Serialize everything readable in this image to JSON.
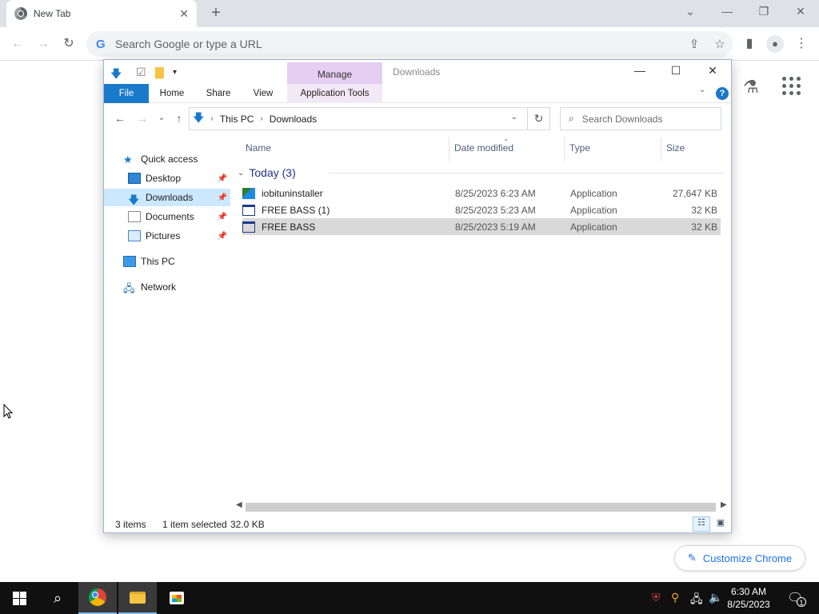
{
  "chrome": {
    "tab_title": "New Tab",
    "omnibox_placeholder": "Search Google or type a URL",
    "customize_label": "Customize Chrome",
    "google_letter": "G"
  },
  "explorer": {
    "title": "Downloads",
    "manage_label": "Manage",
    "ribbon_tabs": {
      "file": "File",
      "home": "Home",
      "share": "Share",
      "view": "View",
      "app_tools": "Application Tools"
    },
    "breadcrumb": [
      "This PC",
      "Downloads"
    ],
    "search_placeholder": "Search Downloads",
    "sidebar": {
      "quick_access": "Quick access",
      "desktop": "Desktop",
      "downloads": "Downloads",
      "documents": "Documents",
      "pictures": "Pictures",
      "this_pc": "This PC",
      "network": "Network"
    },
    "columns": {
      "name": "Name",
      "date": "Date modified",
      "type": "Type",
      "size": "Size"
    },
    "group_header": "Today (3)",
    "files": [
      {
        "name": "iobituninstaller",
        "date": "8/25/2023 6:23 AM",
        "type": "Application",
        "size": "27,647 KB"
      },
      {
        "name": "FREE BASS (1)",
        "date": "8/25/2023 5:23 AM",
        "type": "Application",
        "size": "32 KB"
      },
      {
        "name": "FREE BASS",
        "date": "8/25/2023 5:19 AM",
        "type": "Application",
        "size": "32 KB"
      }
    ],
    "status": {
      "items": "3 items",
      "selected": "1 item selected",
      "size": "32.0 KB"
    }
  },
  "taskbar": {
    "time": "6:30 AM",
    "date": "8/25/2023",
    "notification_count": "1"
  },
  "colors": {
    "accent_blue": "#1979ca",
    "manage_purple": "#e6cdf2",
    "selection_gray": "#d9d9d9",
    "sidebar_selected": "#cce8ff",
    "taskbar": "#101010",
    "chrome_link": "#1a73e8"
  }
}
